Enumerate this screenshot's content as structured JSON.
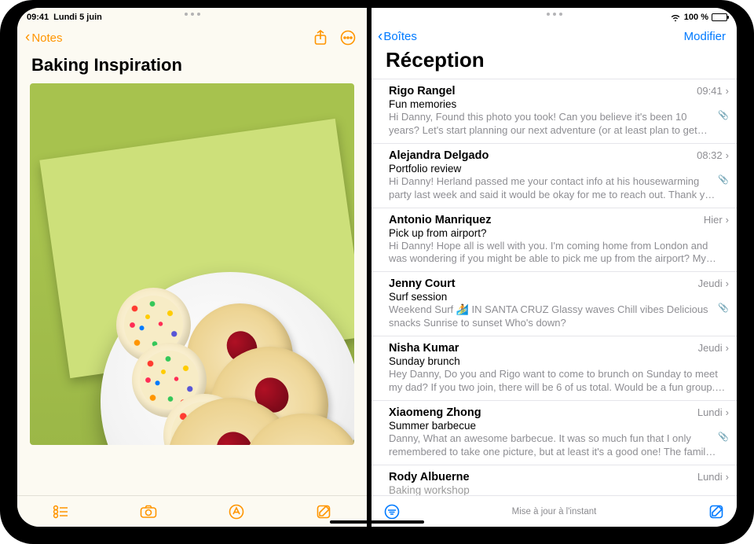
{
  "status": {
    "time": "09:41",
    "date": "Lundi 5 juin",
    "battery": "100 %"
  },
  "notes": {
    "back_label": "Notes",
    "title": "Baking Inspiration"
  },
  "mail": {
    "back_label": "Boîtes",
    "edit_label": "Modifier",
    "title": "Réception",
    "status_text": "Mise à jour à l'instant",
    "items": [
      {
        "sender": "Rigo Rangel",
        "subject": "Fun memories",
        "preview": "Hi Danny, Found this photo you took! Can you believe it's been 10 years? Let's start planning our next adventure (or at least plan to get together soon!) P.S…",
        "time": "09:41",
        "attachment": true
      },
      {
        "sender": "Alejandra Delgado",
        "subject": "Portfolio review",
        "preview": "Hi Danny! Herland passed me your contact info at his housewarming party last week and said it would be okay for me to reach out. Thank you so, so m…",
        "time": "08:32",
        "attachment": true
      },
      {
        "sender": "Antonio Manriquez",
        "subject": "Pick up from airport?",
        "preview": "Hi Danny! Hope all is well with you. I'm coming home from London and was wondering if you might be able to pick me up from the airport? My flight lan…",
        "time": "Hier",
        "attachment": false
      },
      {
        "sender": "Jenny Court",
        "subject": "Surf session",
        "preview": "Weekend Surf 🏄 IN SANTA CRUZ Glassy waves Chill vibes Delicious snacks Sunrise to sunset Who's down?",
        "time": "Jeudi",
        "attachment": true
      },
      {
        "sender": "Nisha Kumar",
        "subject": "Sunday brunch",
        "preview": "Hey Danny, Do you and Rigo want to come to brunch on Sunday to meet my dad? If you two join, there will be 6 of us total. Would be a fun group. Even if…",
        "time": "Jeudi",
        "attachment": false
      },
      {
        "sender": "Xiaomeng Zhong",
        "subject": "Summer barbecue",
        "preview": "Danny, What an awesome barbecue. It was so much fun that I only remembered to take one picture, but at least it's a good one! The family and…",
        "time": "Lundi",
        "attachment": true
      },
      {
        "sender": "Rody Albuerne",
        "subject": "Baking workshop",
        "preview": "",
        "time": "Lundi",
        "attachment": false
      }
    ]
  }
}
